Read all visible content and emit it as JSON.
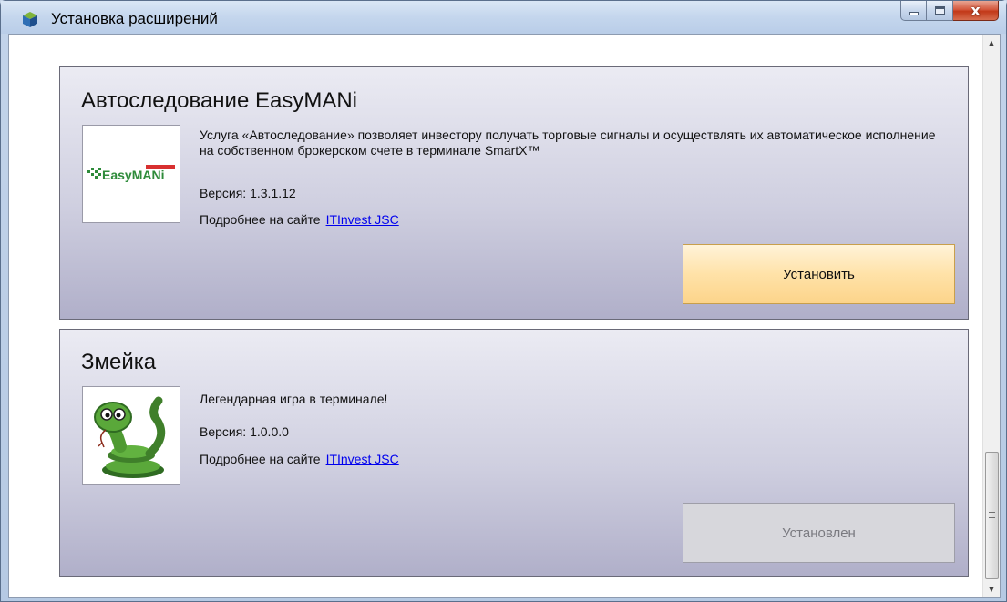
{
  "window": {
    "title": "Установка расширений",
    "close_glyph": "x",
    "icons": {
      "app": "package-cube-icon",
      "minimize": "minimize-icon",
      "maximize": "maximize-icon",
      "close": "close-icon"
    }
  },
  "extensions": [
    {
      "title": "Автоследование EasyMANi",
      "logo_icon": "easymani-logo",
      "logo_text": "EasyMANi",
      "description": "Услуга «Автоследование» позволяет инвестору получать торговые сигналы и осуществлять их автоматическое исполнение на собственном брокерском счете в терминале SmartX™",
      "version": "Версия: 1.3.1.12",
      "more_label": "Подробнее на сайте",
      "link_text": "ITInvest JSC",
      "button_label": "Установить",
      "button_state": "install"
    },
    {
      "title": "Змейка",
      "logo_icon": "snake-icon",
      "description": "Легендарная игра в терминале!",
      "version": "Версия: 1.0.0.0",
      "more_label": "Подробнее на сайте",
      "link_text": "ITInvest JSC",
      "button_label": "Установлен",
      "button_state": "installed"
    }
  ],
  "scrollbar": {
    "thumb_position": 0.78
  },
  "colors": {
    "accent_button": "#fcd48a",
    "link": "#0000ee",
    "card_gradient_top": "#ebebf3",
    "card_gradient_bottom": "#b0afc9",
    "installed_button": "#d7d7dc"
  }
}
